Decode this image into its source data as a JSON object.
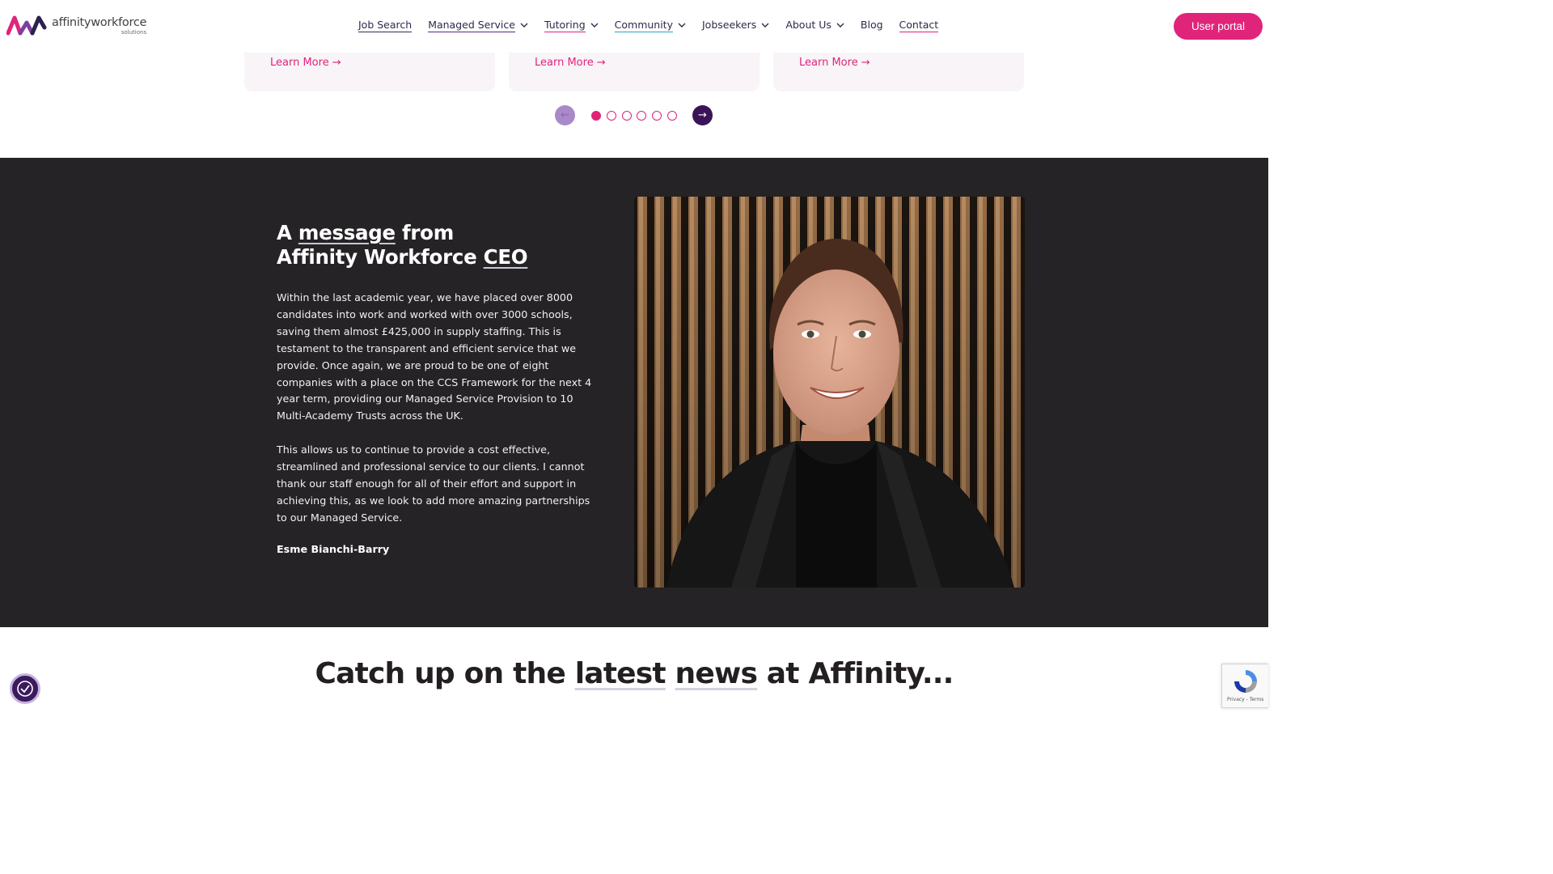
{
  "brand": {
    "name": "affinityworkforce",
    "tagline": "solutions",
    "pink": "#e0247a",
    "purple": "#3a1457",
    "dark_bg": "#252325"
  },
  "nav": {
    "items": [
      {
        "label": "Job Search",
        "dropdown": false
      },
      {
        "label": "Managed Service",
        "dropdown": true
      },
      {
        "label": "Tutoring",
        "dropdown": true
      },
      {
        "label": "Community",
        "dropdown": true
      },
      {
        "label": "Jobseekers",
        "dropdown": true
      },
      {
        "label": "About Us",
        "dropdown": true
      },
      {
        "label": "Blog",
        "dropdown": false
      },
      {
        "label": "Contact",
        "dropdown": false
      }
    ],
    "portal_label": "User portal"
  },
  "carousel": {
    "cards": [
      {
        "link_label": "Learn More"
      },
      {
        "link_label": "Learn More"
      },
      {
        "link_label": "Learn More"
      }
    ],
    "dot_count": 6,
    "active_dot": 1
  },
  "ceo": {
    "title_line1_pre": "A ",
    "title_line1_hl": "message",
    "title_line1_post": " from",
    "title_line2_pre": "Affinity Workforce ",
    "title_line2_hl": "CEO",
    "paragraph1": "Within the last academic year, we have placed over 8000 candidates into work and worked with over 3000 schools, saving them almost £425,000 in supply staffing. This is testament to the transparent and efficient service that we provide. Once again, we are proud to be one of eight companies with a place on the CCS Framework for the next 4 year term, providing our Managed Service Provision to 10 Multi-Academy Trusts across the UK.",
    "paragraph2": "This allows us to continue to provide a cost effective, streamlined and professional service to our clients. I cannot thank our staff enough for all of their effort and support in achieving this, as we look to add more amazing partnerships to our Managed Service.",
    "name": "Esme Bianchi-Barry"
  },
  "news": {
    "pre": "Catch up on the ",
    "hl1": "latest",
    "mid": " ",
    "hl2": "news",
    "post": " at Affinity..."
  },
  "recaptcha": {
    "terms": "Privacy - Terms"
  }
}
